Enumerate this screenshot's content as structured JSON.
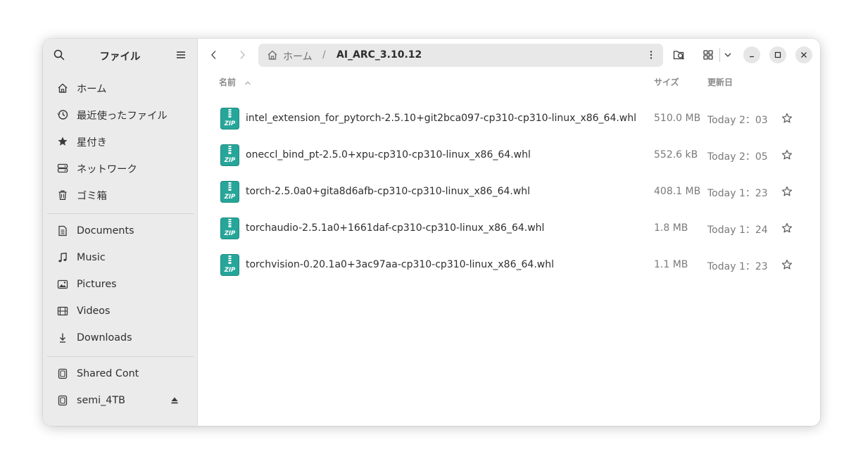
{
  "app": {
    "title": "ファイル"
  },
  "sidebar": {
    "places": [
      {
        "label": "ホーム",
        "icon": "home-icon"
      },
      {
        "label": "最近使ったファイル",
        "icon": "recent-icon"
      },
      {
        "label": "星付き",
        "icon": "star-icon"
      },
      {
        "label": "ネットワーク",
        "icon": "network-icon"
      },
      {
        "label": "ゴミ箱",
        "icon": "trash-icon"
      }
    ],
    "bookmarks": [
      {
        "label": "Documents",
        "icon": "document-icon"
      },
      {
        "label": "Music",
        "icon": "music-icon"
      },
      {
        "label": "Pictures",
        "icon": "pictures-icon"
      },
      {
        "label": "Videos",
        "icon": "videos-icon"
      },
      {
        "label": "Downloads",
        "icon": "downloads-icon"
      }
    ],
    "devices": [
      {
        "label": "Shared Cont",
        "icon": "drive-icon"
      },
      {
        "label": "semi_4TB",
        "icon": "drive-icon"
      }
    ]
  },
  "pathbar": {
    "home": "ホーム",
    "separator": "/",
    "current": "AI_ARC_3.10.12"
  },
  "columns": {
    "name": "名前",
    "size": "サイズ",
    "modified": "更新日"
  },
  "files": [
    {
      "name": "intel_extension_for_pytorch-2.5.10+git2bca097-cp310-cp310-linux_x86_64.whl",
      "size": "510.0 MB",
      "modified": "Today 2：03"
    },
    {
      "name": "oneccl_bind_pt-2.5.0+xpu-cp310-cp310-linux_x86_64.whl",
      "size": "552.6 kB",
      "modified": "Today 2：05"
    },
    {
      "name": "torch-2.5.0a0+gita8d6afb-cp310-cp310-linux_x86_64.whl",
      "size": "408.1 MB",
      "modified": "Today 1：23"
    },
    {
      "name": "torchaudio-2.5.1a0+1661daf-cp310-cp310-linux_x86_64.whl",
      "size": "1.8 MB",
      "modified": "Today 1：24"
    },
    {
      "name": "torchvision-0.20.1a0+3ac97aa-cp310-cp310-linux_x86_64.whl",
      "size": "1.1 MB",
      "modified": "Today 1：23"
    }
  ],
  "colors": {
    "zip_icon": "#26a69a",
    "sidebar_bg": "#ebebeb",
    "pathbar_bg": "#e8e8e8"
  }
}
